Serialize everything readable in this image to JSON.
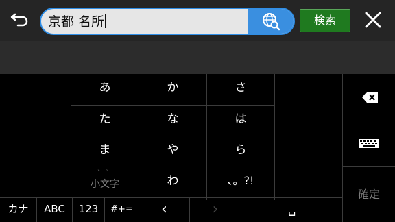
{
  "search": {
    "value": "京都 名所"
  },
  "toolbar": {
    "search_button": "検索"
  },
  "keyboard": {
    "rows": [
      [
        "あ",
        "か",
        "さ"
      ],
      [
        "た",
        "な",
        "は"
      ],
      [
        "ま",
        "や",
        "ら"
      ],
      [
        "小文字",
        "わ",
        "、。?!"
      ]
    ],
    "small_char_dots": "゛ ゜",
    "kakutei": "確定",
    "mode_keys": [
      "カナ",
      "ABC",
      "123",
      "#+="
    ],
    "left_arrow": "‹",
    "right_arrow": "›",
    "space": "␣"
  },
  "colors": {
    "accent": "#2f8ee6",
    "search_button_bg": "#1f7a1f"
  }
}
